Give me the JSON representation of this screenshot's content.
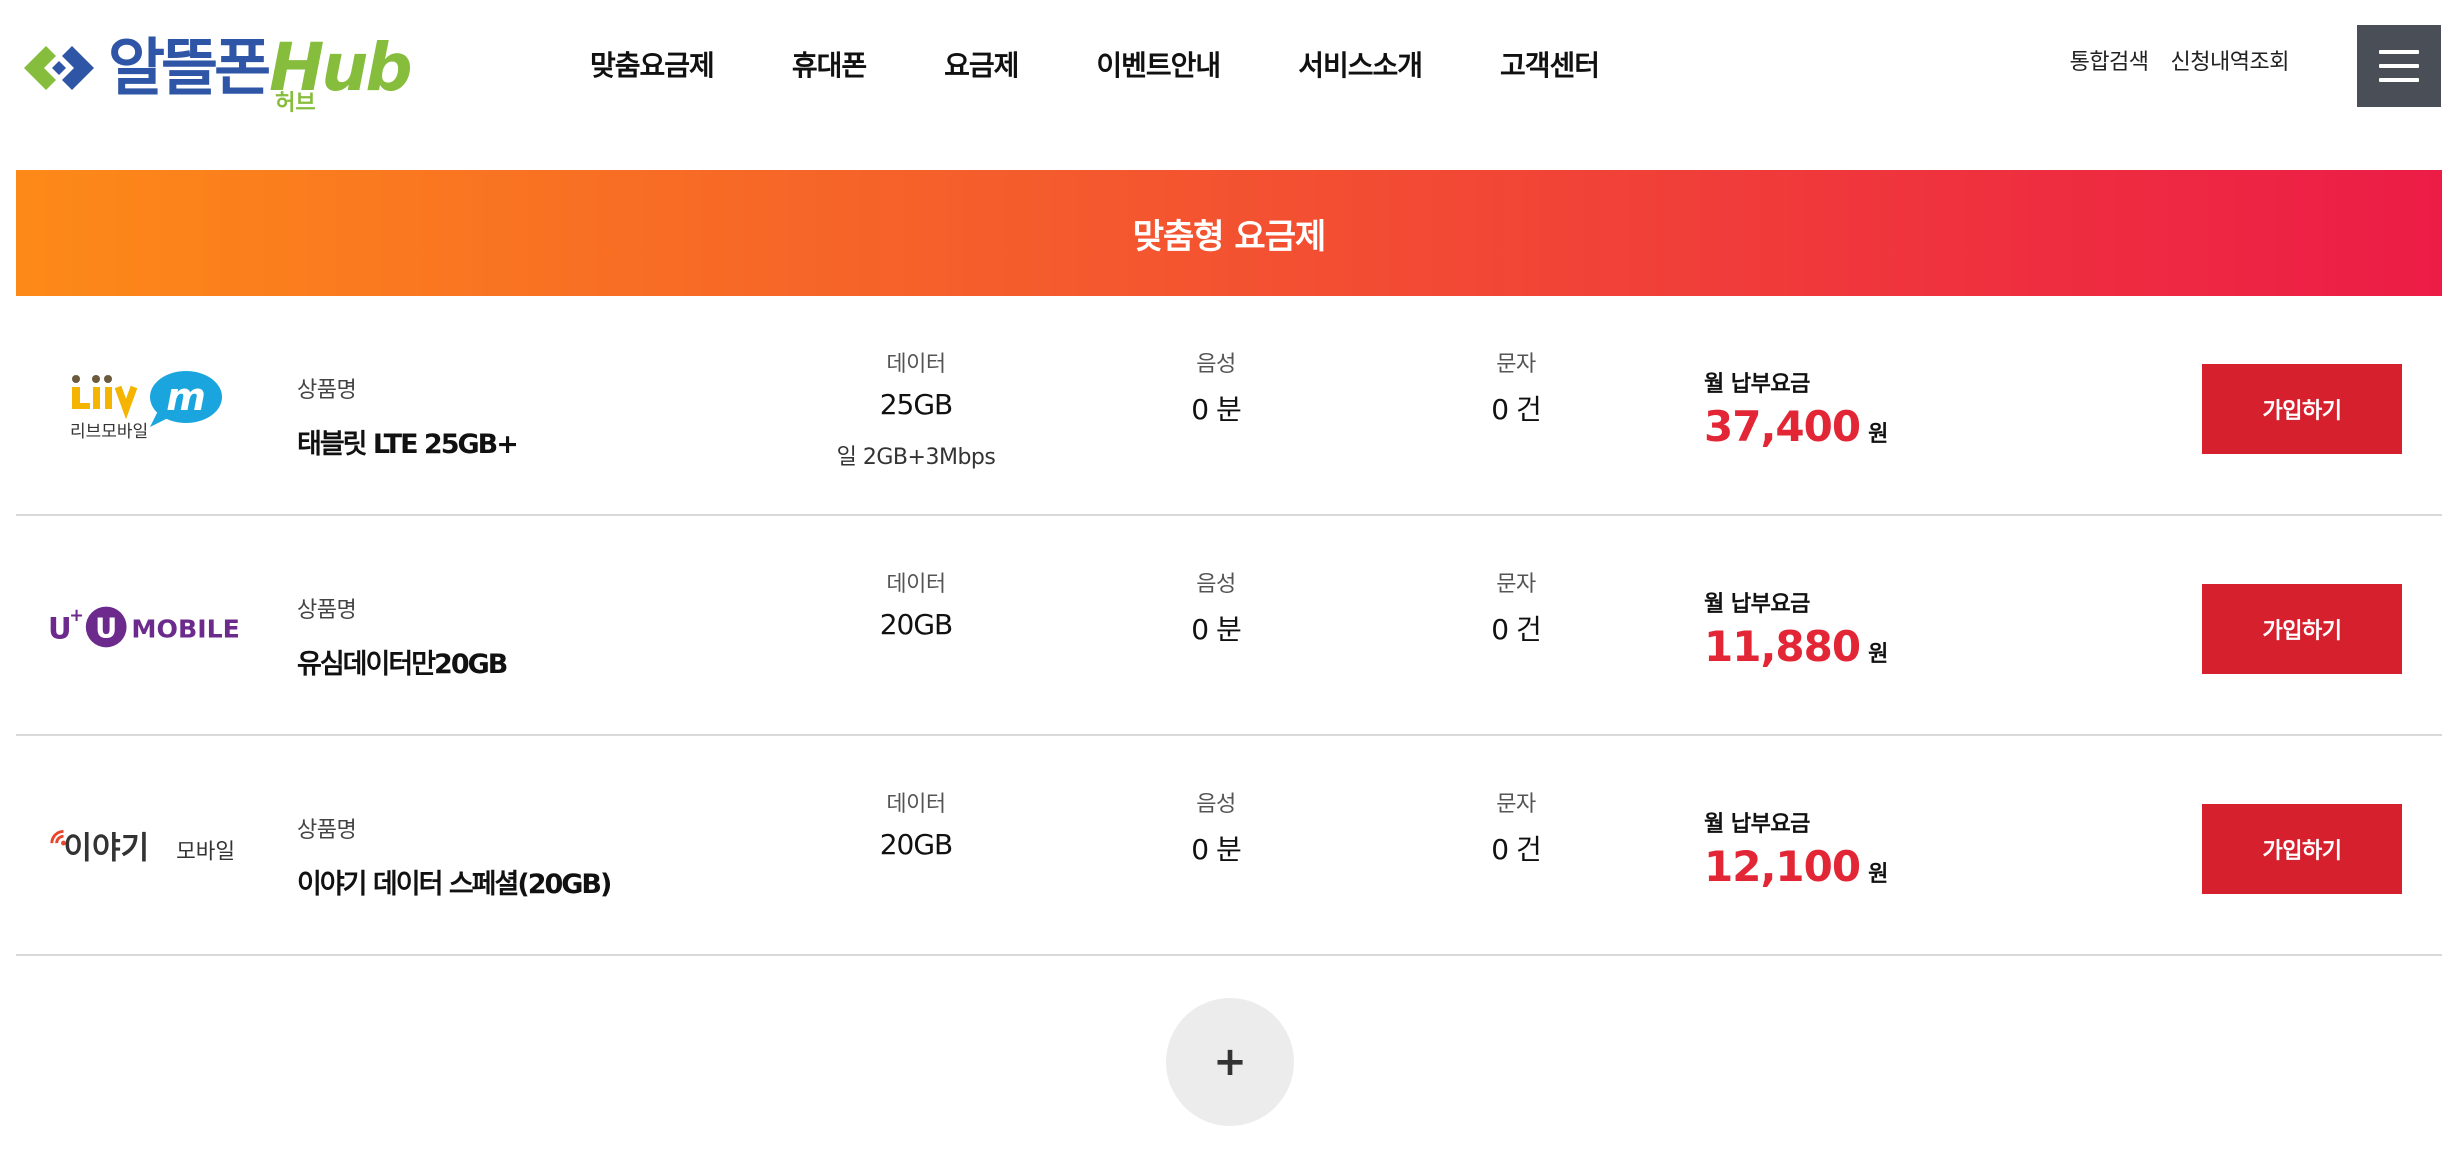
{
  "header": {
    "logo_text": "알뜰폰",
    "logo_hub": "Hub",
    "logo_sub": "허브",
    "nav": [
      {
        "label": "맞춤요금제"
      },
      {
        "label": "휴대폰"
      },
      {
        "label": "요금제"
      },
      {
        "label": "이벤트안내"
      },
      {
        "label": "서비스소개"
      },
      {
        "label": "고객센터"
      }
    ],
    "util": [
      {
        "label": "통합검색"
      },
      {
        "label": "신청내역조회"
      }
    ],
    "menu_icon": "hamburger-icon"
  },
  "banner": {
    "title": "맞춤형 요금제"
  },
  "plans": [
    {
      "carrier": "Liiv M 리브모바일",
      "carrier_logo": {
        "word": "Liiv",
        "mark": "m",
        "sub": "리브모바일"
      },
      "product_label": "상품명",
      "product_name": "태블릿 LTE 25GB+",
      "data_label": "데이터",
      "data_value": "25GB",
      "data_extra": "일 2GB+3Mbps",
      "voice_label": "음성",
      "voice_value": "0 분",
      "sms_label": "문자",
      "sms_value": "0 건",
      "price_label": "월 납부요금",
      "price_value": "37,400",
      "price_unit": "원",
      "join_label": "가입하기"
    },
    {
      "carrier": "U+ UMOBILE",
      "carrier_logo": {
        "prefix": "U",
        "plus": "+",
        "mark": "U",
        "word": "MOBILE"
      },
      "product_label": "상품명",
      "product_name": "유심데이터만20GB",
      "data_label": "데이터",
      "data_value": "20GB",
      "data_extra": "",
      "voice_label": "음성",
      "voice_value": "0 분",
      "sms_label": "문자",
      "sms_value": "0 건",
      "price_label": "월 납부요금",
      "price_value": "11,880",
      "price_unit": "원",
      "join_label": "가입하기"
    },
    {
      "carrier": "이야기 모바일",
      "carrier_logo": {
        "word": "이야기",
        "sub": "모바일"
      },
      "product_label": "상품명",
      "product_name": "이야기 데이터 스페셜(20GB)",
      "data_label": "데이터",
      "data_value": "20GB",
      "data_extra": "",
      "voice_label": "음성",
      "voice_value": "0 분",
      "sms_label": "문자",
      "sms_value": "0 건",
      "price_label": "월 납부요금",
      "price_value": "12,100",
      "price_unit": "원",
      "join_label": "가입하기"
    }
  ],
  "more": {
    "label": "+"
  },
  "colors": {
    "brand_blue": "#2f56a6",
    "brand_green": "#86bd3c",
    "accent_red": "#d7202e",
    "price_red": "#e32636",
    "banner_start": "#fd8a18",
    "banner_end": "#ec1c47"
  }
}
